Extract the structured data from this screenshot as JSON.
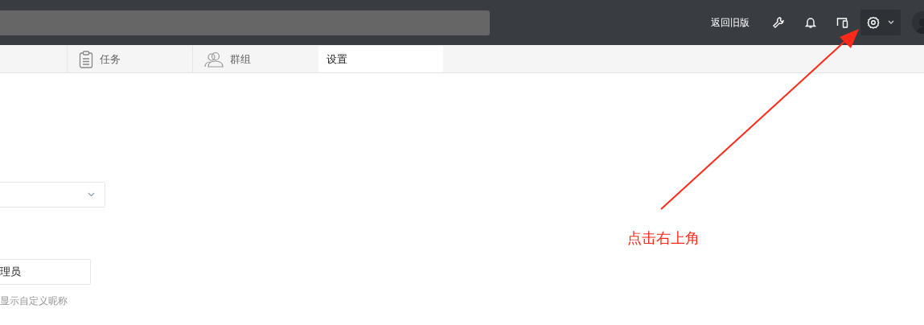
{
  "top_bar": {
    "old_version_link": "返回旧版",
    "tools": [
      {
        "kind": "wrench",
        "selected": false
      },
      {
        "kind": "bell",
        "selected": false
      },
      {
        "kind": "devices",
        "selected": false
      },
      {
        "kind": "gear",
        "selected": true
      }
    ]
  },
  "tabs": [
    {
      "label": "任务",
      "kind": "task",
      "selected": false
    },
    {
      "label": "群组",
      "kind": "group",
      "selected": false
    },
    {
      "label": "设置",
      "kind": "plain",
      "selected": true
    }
  ],
  "form": {
    "name_value": "理员",
    "hint": "显示自定义昵称"
  },
  "annotation": {
    "text": "点击右上角"
  }
}
